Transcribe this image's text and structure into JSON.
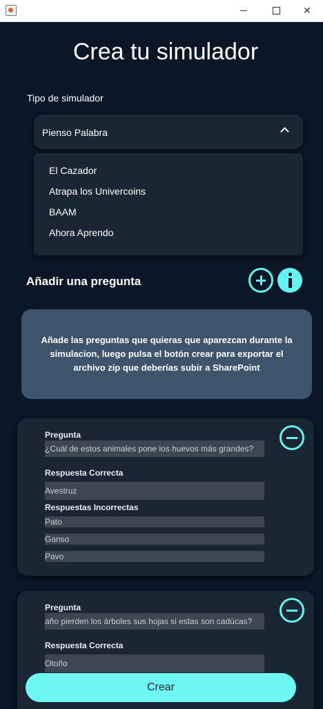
{
  "window": {
    "minimize_icon": "minimize-icon",
    "maximize_icon": "maximize-icon",
    "close_icon": "close-icon",
    "close_glyph": "✕"
  },
  "page": {
    "title": "Crea tu simulador",
    "tipo_label": "Tipo de simulador"
  },
  "combo": {
    "selected": "Pienso Palabra",
    "options": [
      "El Cazador",
      "Atrapa los Univercoins",
      "BAAM",
      "Ahora Aprendo"
    ]
  },
  "add_section": {
    "label": "Añadir una pregunta",
    "info_text": "Añade las preguntas que quieras que aparezcan durante la simulacion, luego pulsa el botón crear para exportar el archivo zip que deberías subir a SharePoint"
  },
  "labels": {
    "pregunta": "Pregunta",
    "respuesta_correcta": "Respuesta Correcta",
    "respuestas_incorrectas": "Respuestas Incorrectas"
  },
  "questions": [
    {
      "pregunta": "¿Cuál de estos animales pone los huevos más grandes?",
      "correcta": "Avestruz",
      "incorrectas": [
        "Pato",
        "Ganso",
        "Pavo"
      ]
    },
    {
      "pregunta": "año pierden los árboles sus hojas si estas son cadúcas?",
      "correcta": "Otoño"
    }
  ],
  "crear_label": "Crear",
  "colors": {
    "background": "#0b1626",
    "card": "#1b2635",
    "accent": "#62f4ee",
    "info_box": "#3e536c"
  }
}
